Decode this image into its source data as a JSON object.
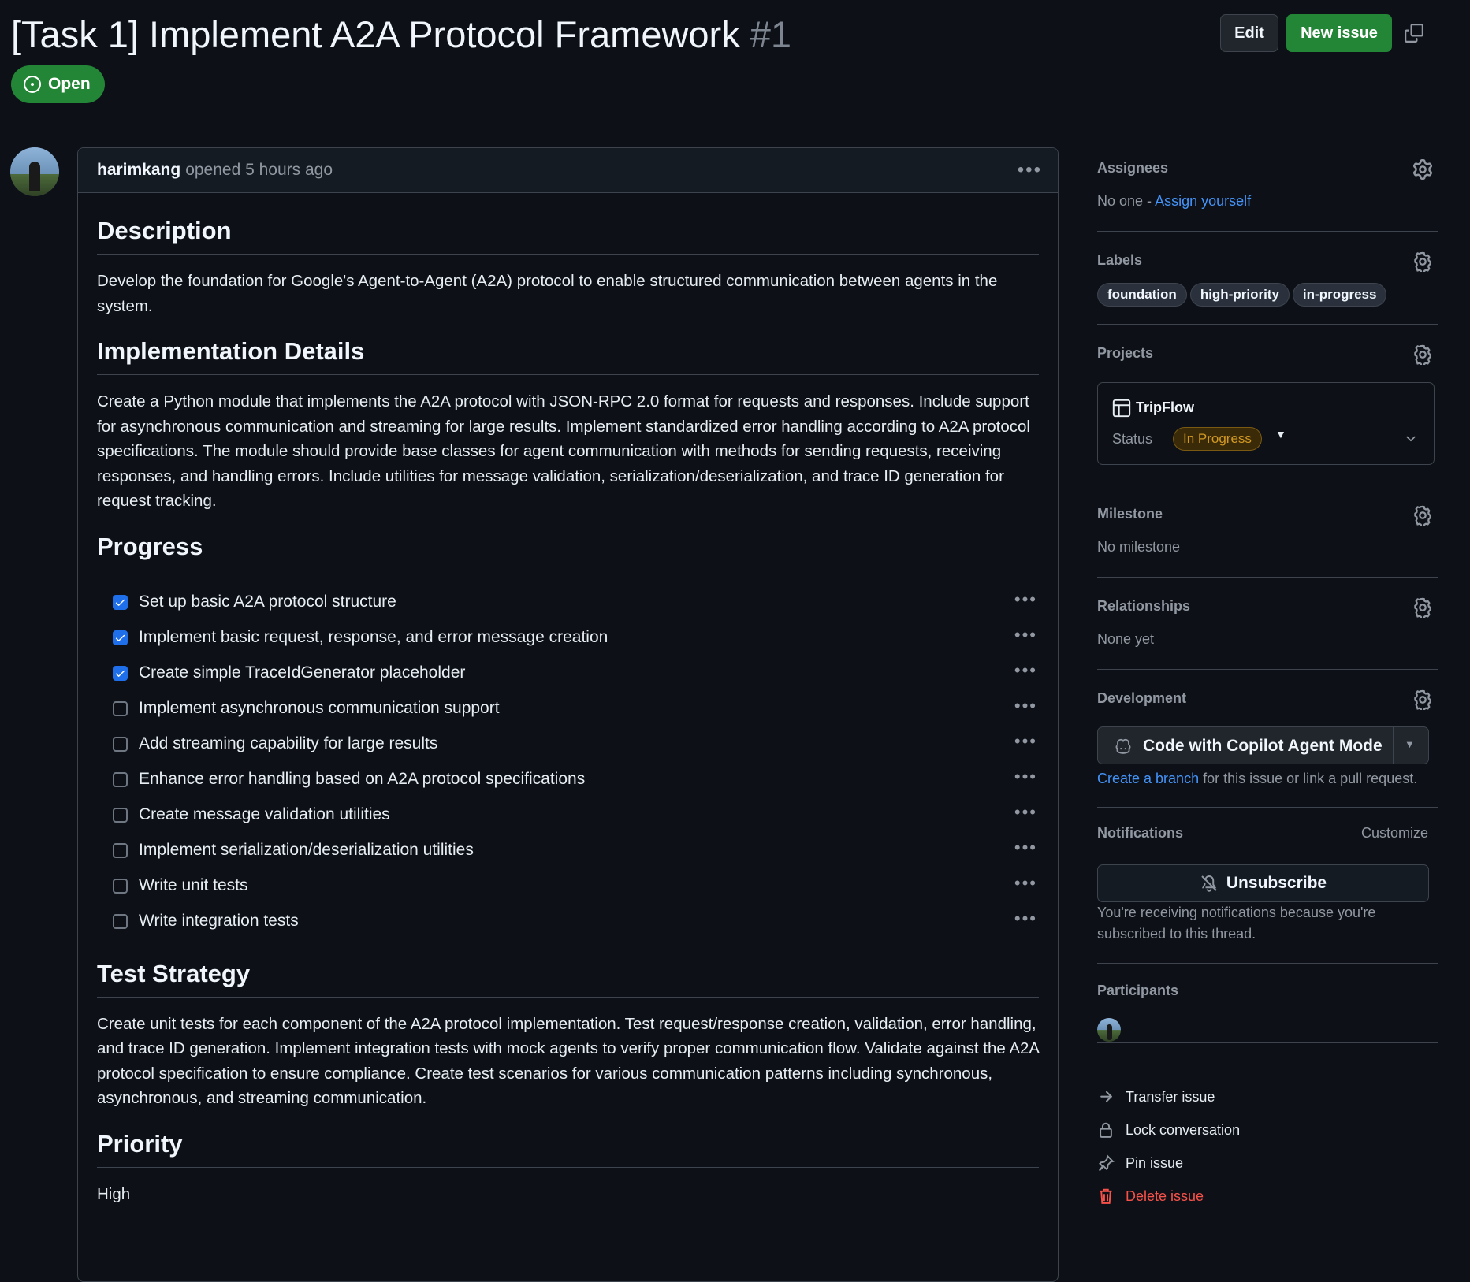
{
  "issue": {
    "title": "[Task 1] Implement A2A Protocol Framework",
    "number": "#1",
    "state": "Open"
  },
  "header_actions": {
    "edit": "Edit",
    "new_issue": "New issue"
  },
  "comment": {
    "author": "harimkang",
    "meta": "opened 5 hours ago",
    "sections": {
      "description": {
        "heading": "Description",
        "text": "Develop the foundation for Google's Agent-to-Agent (A2A) protocol to enable structured communication between agents in the system."
      },
      "implementation": {
        "heading": "Implementation Details",
        "text": "Create a Python module that implements the A2A protocol with JSON-RPC 2.0 format for requests and responses. Include support for asynchronous communication and streaming for large results. Implement standardized error handling according to A2A protocol specifications. The module should provide base classes for agent communication with methods for sending requests, receiving responses, and handling errors. Include utilities for message validation, serialization/deserialization, and trace ID generation for request tracking."
      },
      "progress": {
        "heading": "Progress",
        "tasks": [
          {
            "label": "Set up basic A2A protocol structure",
            "checked": true
          },
          {
            "label": "Implement basic request, response, and error message creation",
            "checked": true
          },
          {
            "label": "Create simple TraceIdGenerator placeholder",
            "checked": true
          },
          {
            "label": "Implement asynchronous communication support",
            "checked": false
          },
          {
            "label": "Add streaming capability for large results",
            "checked": false
          },
          {
            "label": "Enhance error handling based on A2A protocol specifications",
            "checked": false
          },
          {
            "label": "Create message validation utilities",
            "checked": false
          },
          {
            "label": "Implement serialization/deserialization utilities",
            "checked": false
          },
          {
            "label": "Write unit tests",
            "checked": false
          },
          {
            "label": "Write integration tests",
            "checked": false
          }
        ]
      },
      "test_strategy": {
        "heading": "Test Strategy",
        "text": "Create unit tests for each component of the A2A protocol implementation. Test request/response creation, validation, error handling, and trace ID generation. Implement integration tests with mock agents to verify proper communication flow. Validate against the A2A protocol specification to ensure compliance. Create test scenarios for various communication patterns including synchronous, asynchronous, and streaming communication."
      },
      "priority": {
        "heading": "Priority",
        "text": "High"
      }
    }
  },
  "sidebar": {
    "assignees": {
      "title": "Assignees",
      "none": "No one -",
      "assign_link": "Assign yourself"
    },
    "labels": {
      "title": "Labels",
      "items": [
        "foundation",
        "high-priority",
        "in-progress"
      ]
    },
    "projects": {
      "title": "Projects",
      "project_name": "TripFlow",
      "status_label": "Status",
      "status_value": "In Progress"
    },
    "milestone": {
      "title": "Milestone",
      "value": "No milestone"
    },
    "relationships": {
      "title": "Relationships",
      "value": "None yet"
    },
    "development": {
      "title": "Development",
      "copilot_button": "Code with Copilot Agent Mode",
      "create_branch_link": "Create a branch",
      "create_branch_rest": "for this issue or link a pull request."
    },
    "notifications": {
      "title": "Notifications",
      "customize": "Customize",
      "unsubscribe": "Unsubscribe",
      "reason": "You're receiving notifications because you're subscribed to this thread."
    },
    "participants": {
      "title": "Participants"
    },
    "actions": {
      "transfer": "Transfer issue",
      "lock": "Lock conversation",
      "pin": "Pin issue",
      "delete": "Delete issue"
    }
  },
  "colors": {
    "background": "#0d1117",
    "open_green": "#238636",
    "link_blue": "#4493f8",
    "danger_red": "#f85149",
    "status_yellow": "#d29922"
  }
}
